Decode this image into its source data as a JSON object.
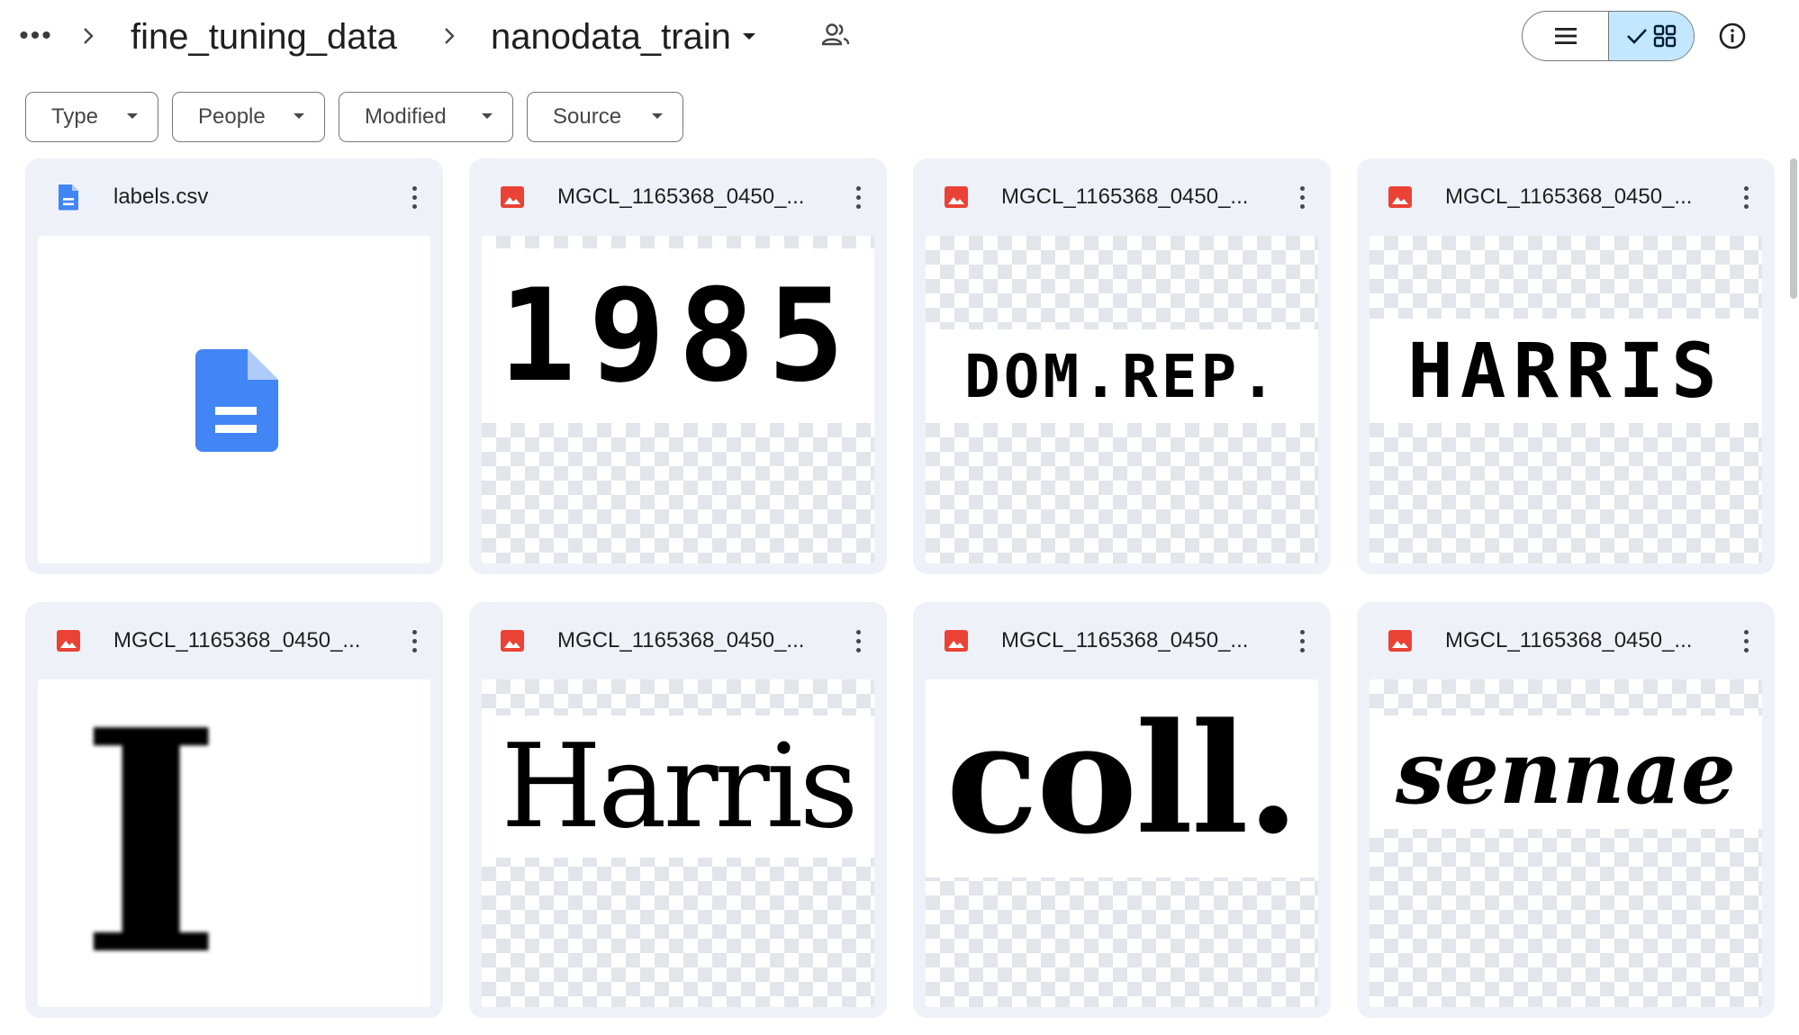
{
  "breadcrumb": {
    "more": "•••",
    "parent": "fine_tuning_data",
    "current": "nanodata_train"
  },
  "colors": {
    "accent_selected": "#c2e7ff",
    "doc_blue": "#4285f4",
    "image_red": "#ea4335",
    "card_bg": "#eef2f8"
  },
  "filters": [
    "Type",
    "People",
    "Modified",
    "Source"
  ],
  "files": [
    {
      "name": "labels.csv",
      "kind": "doc",
      "icon": "doc-icon"
    },
    {
      "name": "MGCL_1165368_0450_...",
      "kind": "image",
      "icon": "image-icon",
      "preview_text": "1985"
    },
    {
      "name": "MGCL_1165368_0450_...",
      "kind": "image",
      "icon": "image-icon",
      "preview_text": "DOM.REP."
    },
    {
      "name": "MGCL_1165368_0450_...",
      "kind": "image",
      "icon": "image-icon",
      "preview_text": "HARRIS"
    },
    {
      "name": "MGCL_1165368_0450_...",
      "kind": "image",
      "icon": "image-icon",
      "preview_text": "I"
    },
    {
      "name": "MGCL_1165368_0450_...",
      "kind": "image",
      "icon": "image-icon",
      "preview_text": "Harris"
    },
    {
      "name": "MGCL_1165368_0450_...",
      "kind": "image",
      "icon": "image-icon",
      "preview_text": "coll."
    },
    {
      "name": "MGCL_1165368_0450_...",
      "kind": "image",
      "icon": "image-icon",
      "preview_text": "sennae"
    }
  ]
}
